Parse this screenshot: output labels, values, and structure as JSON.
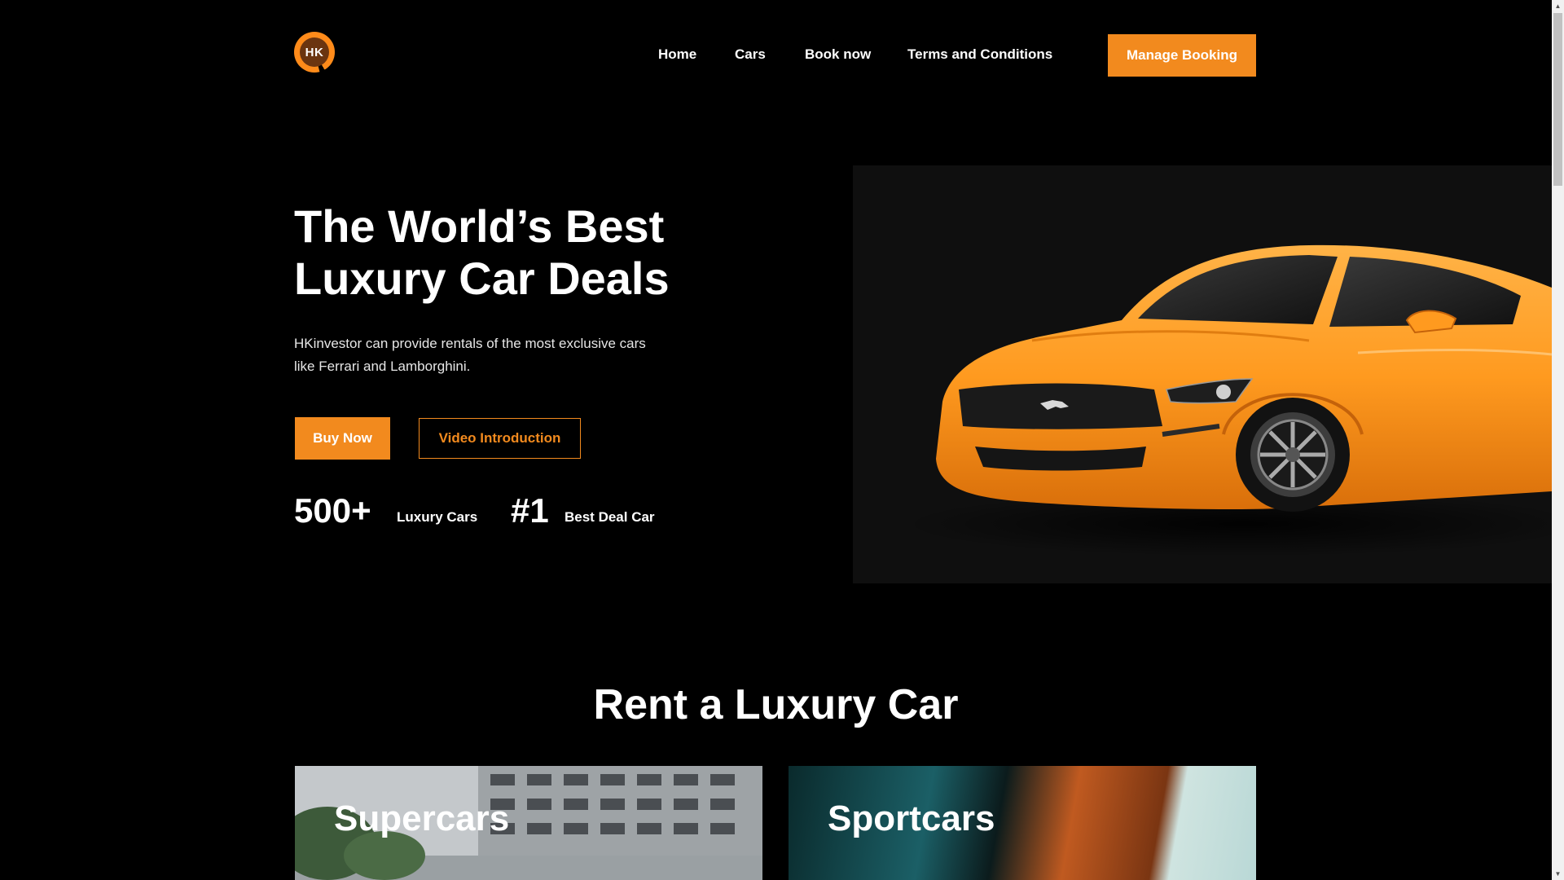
{
  "header": {
    "logo_text": "HK",
    "nav": {
      "home": "Home",
      "cars": "Cars",
      "book": "Book now",
      "terms": "Terms and Conditions"
    },
    "manage_booking": "Manage Booking"
  },
  "hero": {
    "title_line1": "The World’s Best",
    "title_line2": "Luxury Car Deals",
    "description_line1": "HKinvestor can provide rentals of the most exclusive cars",
    "description_line2": "like Ferrari and Lamborghini.",
    "buy_now": "Buy Now",
    "video_intro": "Video Introduction",
    "stats": [
      {
        "value": "500+",
        "label": "Luxury Cars"
      },
      {
        "value": "#1",
        "label": "Best Deal Car"
      }
    ]
  },
  "section": {
    "title": "Rent a Luxury Car",
    "cards": [
      {
        "title": "Supercars"
      },
      {
        "title": "Sportcars"
      }
    ]
  },
  "colors": {
    "accent": "#f28a1e",
    "background": "#000000",
    "car_body": "#ff9a1f"
  }
}
